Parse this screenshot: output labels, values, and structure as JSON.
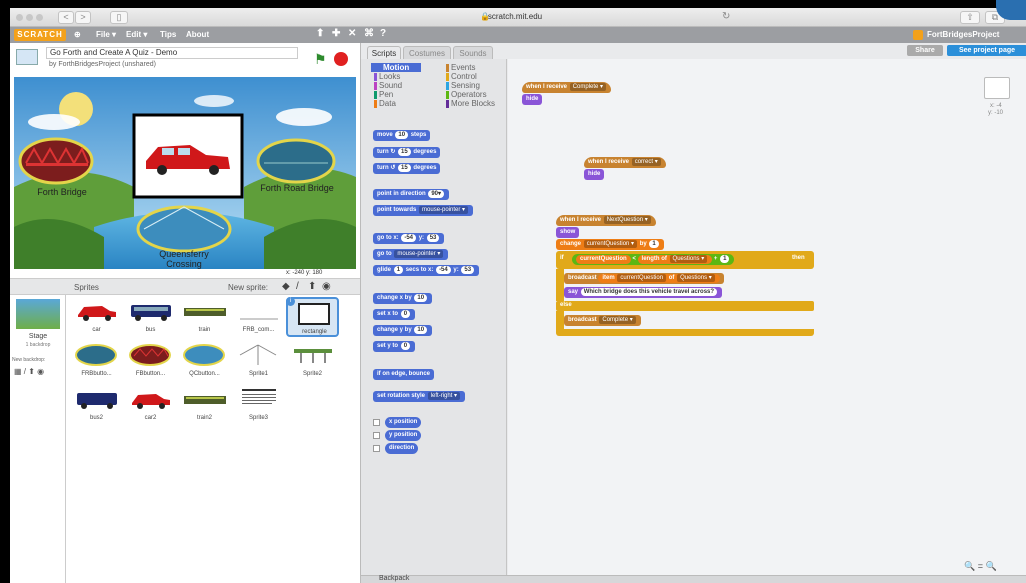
{
  "browser": {
    "url": "scratch.mit.edu",
    "nav_back": "<",
    "nav_forward": ">"
  },
  "menubar": {
    "logo": "SCRATCH",
    "items": [
      "File ▾",
      "Edit ▾",
      "Tips",
      "About"
    ],
    "account": "FortBridgesProject",
    "share": "Share",
    "see_project": "See project page"
  },
  "project": {
    "title": "Go Forth and Create A Quiz - Demo",
    "byline": "by ForthBridgesProject (unshared)"
  },
  "stage": {
    "labels": [
      "Forth Bridge",
      "Forth Road Bridge",
      "Queensferry Crossing"
    ],
    "coords": "x: -240  y: 180"
  },
  "sprites_panel": {
    "header": "Sprites",
    "new_sprite": "New sprite:",
    "stage_label": "Stage",
    "stage_sub": "1 backdrop",
    "new_backdrop": "New backdrop:",
    "sprites": [
      "car",
      "bus",
      "train",
      "FRB_com...",
      "rectangle",
      "FRBbutto...",
      "FBbutton...",
      "QCbutton...",
      "Sprite1",
      "Sprite2",
      "bus2",
      "car2",
      "train2",
      "Sprite3"
    ]
  },
  "editor": {
    "tabs": [
      "Scripts",
      "Costumes",
      "Sounds"
    ],
    "categories": [
      {
        "name": "Motion",
        "color": "#4a6cd4"
      },
      {
        "name": "Looks",
        "color": "#8a55d7"
      },
      {
        "name": "Sound",
        "color": "#bb42c3"
      },
      {
        "name": "Pen",
        "color": "#0e9a6c"
      },
      {
        "name": "Data",
        "color": "#ee7d16"
      },
      {
        "name": "Events",
        "color": "#c88330"
      },
      {
        "name": "Control",
        "color": "#e1a91a"
      },
      {
        "name": "Sensing",
        "color": "#2ca5e2"
      },
      {
        "name": "Operators",
        "color": "#5cb712"
      },
      {
        "name": "More Blocks",
        "color": "#632d99"
      }
    ],
    "motion_blocks": {
      "move": "move",
      "move_val": "10",
      "move_end": "steps",
      "turn_r": "turn ↻",
      "turn_val": "15",
      "degrees": "degrees",
      "turn_l": "turn ↺",
      "point_dir": "point in direction",
      "dir_val": "90▾",
      "point_towards": "point towards",
      "mouse_pointer": "mouse-pointer ▾",
      "goto_xy": "go to x:",
      "x_val": "-54",
      "y_lbl": "y:",
      "y_val": "53",
      "goto": "go to",
      "glide": "glide",
      "glide_val": "1",
      "glide_secs": "secs to x:",
      "change_x": "change x by",
      "change_val": "10",
      "set_x": "set x to",
      "zero": "0",
      "change_y": "change y by",
      "set_y": "set y to",
      "bounce": "if on edge, bounce",
      "rot_style": "set rotation style",
      "rot_val": "left-right ▾",
      "xpos": "x position",
      "ypos": "y position",
      "direction": "direction"
    },
    "scripts": {
      "when_receive": "when I receive",
      "msg_complete": "Complete ▾",
      "msg_correct": "correct ▾",
      "msg_next": "NextQuestion ▾",
      "hide": "hide",
      "show": "show",
      "change": "change",
      "var_cq": "currentQuestion ▾",
      "by": "by",
      "one": "1",
      "if": "if",
      "then": "then",
      "cq": "currentQuestion",
      "lt": "<",
      "length_of": "length of",
      "list_q": "Questions ▾",
      "plus": "+",
      "broadcast": "broadcast",
      "item": "item",
      "of": "of",
      "say": "say",
      "say_text": "Which bridge does this vehicle travel across?",
      "else": "else",
      "bc_complete": "Complete ▾"
    },
    "sprite_info": {
      "x": "x: -4",
      "y": "y: -10"
    },
    "zoom": "🔍 = 🔍",
    "backpack": "Backpack"
  }
}
